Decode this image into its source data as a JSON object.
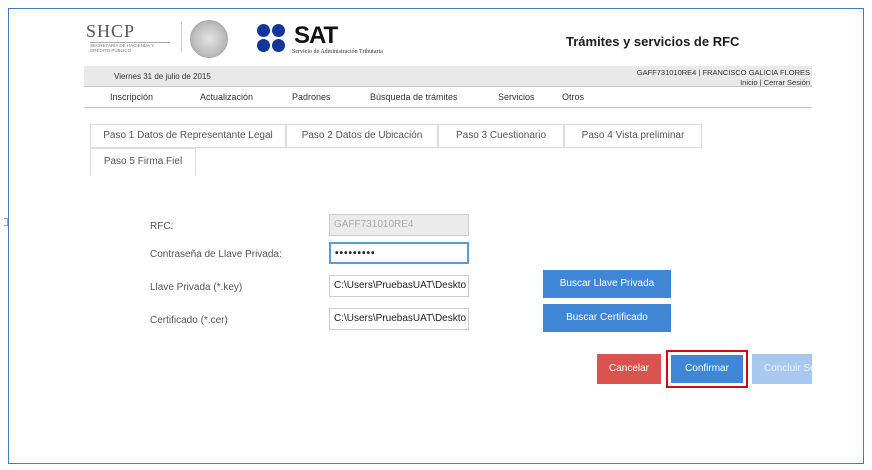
{
  "header": {
    "shcp_title": "SHCP",
    "shcp_subtitle": "SECRETARÍA DE HACIENDA Y CRÉDITO PÚBLICO",
    "sat_title": "SAT",
    "sat_subtitle": "Servicio de Administración Tributaria",
    "page_title": "Trámites y servicios de RFC"
  },
  "info_bar": {
    "date": "Viernes 31 de julio de 2015",
    "user": "GAFF731010RE4 | FRANCISCO GALICIA FLORES",
    "link_inicio": "Inicio",
    "separator": " | ",
    "link_logout": "Cerrar Sesión"
  },
  "nav": {
    "items": [
      "Inscripción",
      "Actualización",
      "Padrones",
      "Búsqueda de trámites",
      "Servicios",
      "Otros"
    ]
  },
  "tabs": [
    "Paso 1 Datos de Representante Legal",
    "Paso 2 Datos de Ubicación",
    "Paso 3 Cuestionario",
    "Paso 4 Vista preliminar",
    "Paso 5 Firma Fiel"
  ],
  "form": {
    "rfc_label": "RFC:",
    "rfc_value": "GAFF731010RE4",
    "password_label": "Contraseña de Llave Privada:",
    "password_value": "•••••••••",
    "key_label": "Llave Privada (*.key)",
    "key_value": "C:\\Users\\PruebasUAT\\Deskto",
    "cert_label": "Certificado (*.cer)",
    "cert_value": "C:\\Users\\PruebasUAT\\Deskto",
    "buscar_llave": "Buscar Llave Privada",
    "buscar_cert": "Buscar Certificado"
  },
  "actions": {
    "cancel": "Cancelar",
    "confirm": "Confirmar",
    "conclude": "Concluir So"
  },
  "colors": {
    "primary_blue": "#3f86d6",
    "cancel_red": "#d9534f",
    "highlight_red": "#d10a18",
    "sat_blue": "#12369a"
  }
}
